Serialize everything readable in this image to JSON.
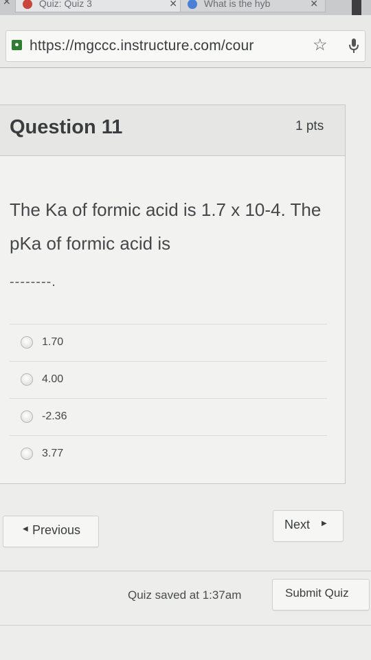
{
  "browser": {
    "tabs": [
      {
        "title": "Quiz: Quiz 3",
        "favicon_color": "#c9463d"
      },
      {
        "title": "What is the hyb",
        "favicon_color": "#4a7fd6"
      }
    ],
    "close_glyph": "✕",
    "url": "https://mgccc.instructure.com/cour"
  },
  "question": {
    "title": "Question 11",
    "points": "1 pts",
    "text": "The Ka of formic acid is 1.7 x 10-4. The pKa of formic acid is",
    "blank": "--------.",
    "answers": [
      {
        "label": "1.70"
      },
      {
        "label": "4.00"
      },
      {
        "label": "-2.36"
      },
      {
        "label": "3.77"
      }
    ]
  },
  "navigation": {
    "previous_label": "Previous",
    "next_label": "Next"
  },
  "footer": {
    "saved_text": "Quiz saved at 1:37am",
    "submit_label": "Submit Quiz"
  }
}
